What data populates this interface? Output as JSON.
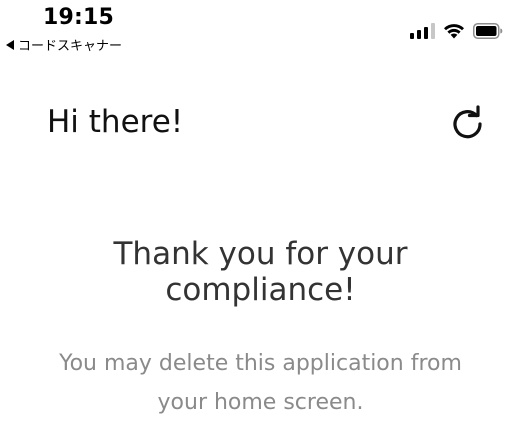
{
  "status_bar": {
    "time": "19:15",
    "back_app_label": "コードスキャナー",
    "icons": [
      "signal-icon",
      "wifi-icon",
      "battery-icon"
    ]
  },
  "header": {
    "title": "Hi there!",
    "refresh_icon": "refresh-icon"
  },
  "message": {
    "headline": "Thank you for your compliance!",
    "body": "You may delete this application from your home screen."
  },
  "colors": {
    "headline": "#333333",
    "body": "#8a8a8a",
    "background": "#ffffff"
  }
}
